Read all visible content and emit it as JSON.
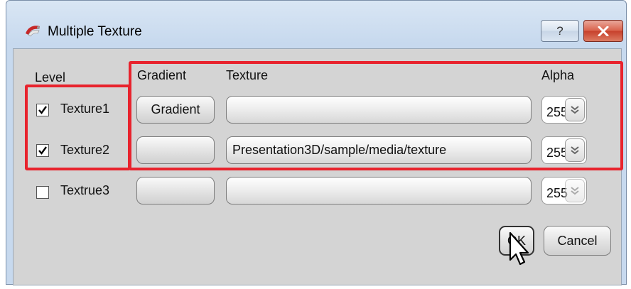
{
  "window": {
    "title": "Multiple Texture",
    "help_label": "?",
    "close_label": "x"
  },
  "headers": {
    "level": "Level",
    "gradient": "Gradient",
    "texture": "Texture",
    "alpha": "Alpha"
  },
  "rows": [
    {
      "label": "Texture1",
      "checked": true,
      "gradient_label": "Gradient",
      "texture_path": "",
      "alpha": "255"
    },
    {
      "label": "Texture2",
      "checked": true,
      "gradient_label": "",
      "texture_path": "Presentation3D/sample/media/texture",
      "alpha": "255"
    },
    {
      "label": "Textrue3",
      "checked": false,
      "gradient_label": "",
      "texture_path": "",
      "alpha": "255"
    }
  ],
  "actions": {
    "ok_label": "OK",
    "cancel_label": "Cancel"
  },
  "colors": {
    "highlight": "#e8232d",
    "close_button": "#c7402b"
  },
  "icons": {
    "app": "paint-swatch-icon",
    "spin": "double-chevron-down-icon",
    "cursor": "mouse-pointer-icon"
  }
}
